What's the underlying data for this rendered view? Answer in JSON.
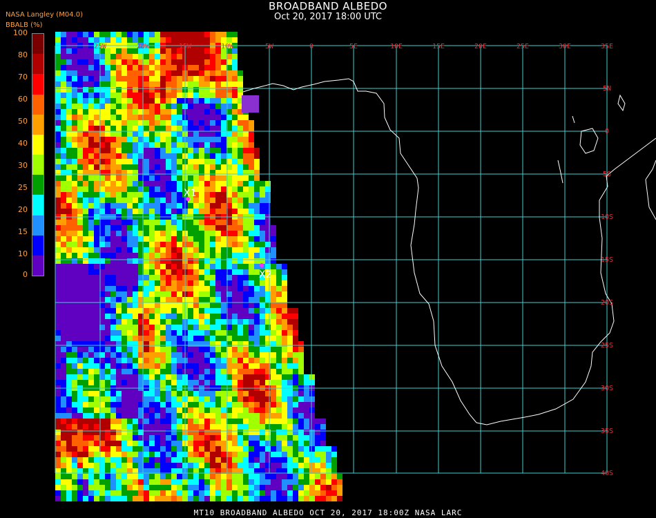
{
  "header": {
    "title": "BROADBAND ALBEDO",
    "subtitle": "Oct 20, 2017 18:00 UTC",
    "source": "NASA Langley (M04.0)"
  },
  "colorbar": {
    "label": "BBALB (%)",
    "ticks": [
      "100",
      "80",
      "70",
      "60",
      "50",
      "40",
      "30",
      "25",
      "20",
      "15",
      "10",
      "0"
    ],
    "colors": [
      "#7a0000",
      "#b00000",
      "#ff0000",
      "#ff6000",
      "#ffa000",
      "#ffff00",
      "#a0ff00",
      "#00a000",
      "#00ffff",
      "#2090ff",
      "#0000ff",
      "#6000c0"
    ]
  },
  "map": {
    "lon_labels": [
      "25W",
      "20W",
      "15W",
      "10W",
      "5W",
      "0",
      "5E",
      "10E",
      "15E",
      "20E",
      "25E",
      "30E",
      "35E"
    ],
    "lat_labels": [
      "5N",
      "0",
      "5S",
      "10S",
      "15S",
      "20S",
      "25S",
      "30S",
      "35S",
      "40S"
    ],
    "grid_color": "#40d0d0",
    "markers": [
      {
        "label": "X1",
        "color": "#ff30ff"
      },
      {
        "label": "X2",
        "color": "#ff30ff"
      }
    ]
  },
  "footer": {
    "text": "MT10  BROADBAND ALBEDO   OCT 20, 2017 18:00Z   NASA LARC"
  }
}
